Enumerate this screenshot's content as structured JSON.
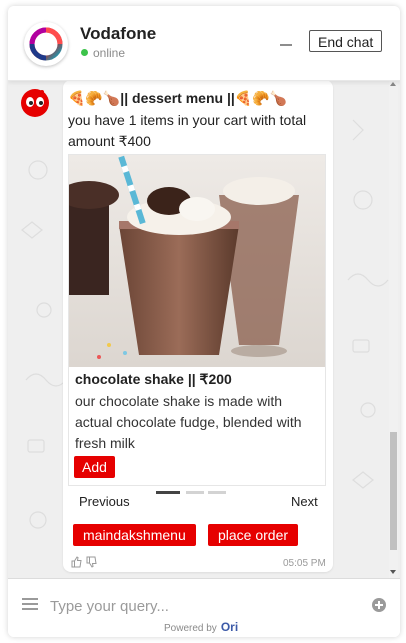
{
  "header": {
    "brand_name": "Vodafone",
    "status": "online",
    "end_chat_label": "End chat"
  },
  "message": {
    "title": "🍕🥐🍗|| dessert menu ||🍕🥐🍗",
    "intro": "you have 1 items in your cart with total amount ₹400",
    "card": {
      "title": "chocolate shake || ₹200",
      "description": "our chocolate shake is made with actual chocolate fudge, blended with fresh milk",
      "add_label": "Add"
    },
    "carousel": {
      "prev_label": "Previous",
      "next_label": "Next",
      "slide_count": 3,
      "active_slide": 1
    },
    "quick_replies": [
      "maindakshmenu",
      "place order"
    ],
    "time": "05:05 PM"
  },
  "footer": {
    "input_placeholder": "Type your query...",
    "powered_by": "Powered by",
    "powered_brand": "Ori"
  },
  "colors": {
    "accent": "#e60000",
    "online": "#3cc34a",
    "chat_bg": "#efefef"
  },
  "icons": [
    "vodafone-logo",
    "bot-avatar",
    "menu-icon",
    "send-icon",
    "thumbs-up-icon",
    "thumbs-down-icon",
    "minimize-icon"
  ]
}
